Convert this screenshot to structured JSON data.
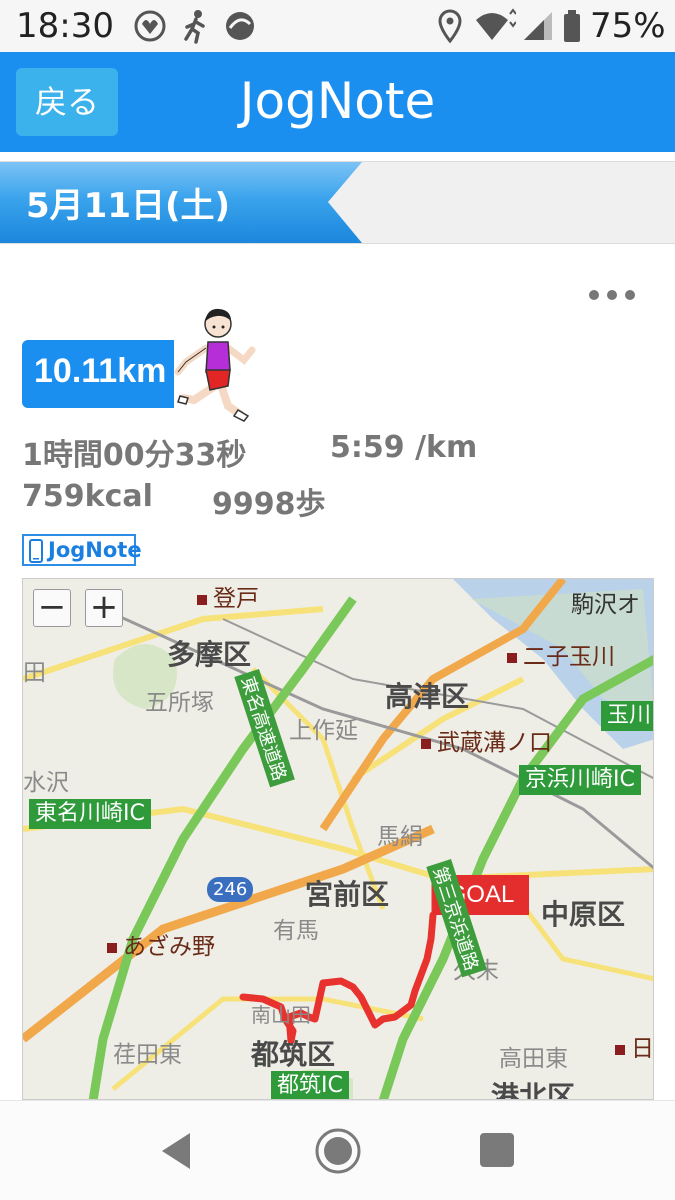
{
  "status_bar": {
    "time": "18:30",
    "battery_percent": "75%",
    "icons": [
      "heart-rate-icon",
      "runner-status-icon",
      "sync-icon",
      "location-icon",
      "wifi-icon",
      "signal-icon",
      "battery-icon"
    ]
  },
  "header": {
    "back_label": "戻る",
    "title": "JogNote"
  },
  "date_strip": {
    "date": "5月11日(土)"
  },
  "record": {
    "distance": "10.11km",
    "duration": "1時間00分33秒",
    "pace": "5:59 /km",
    "calories": "759kcal",
    "steps": "9998歩",
    "logo_text": "JogNote"
  },
  "map": {
    "zoom_out": "−",
    "zoom_in": "+",
    "goal_label": "GOAL",
    "route_color": "#e8322e",
    "labels": {
      "tama": "多摩区",
      "takatsu": "高津区",
      "miyamae": "宮前区",
      "nakahara": "中原区",
      "tsuzuki": "都筑区",
      "kohoku": "港北区",
      "gosho": "五所塚",
      "kamisakunobe": "上作延",
      "mizusawa": "水沢",
      "mabeki": "馬絹",
      "arima": "有馬",
      "kusue": "久末",
      "minamiyamada": "南山田",
      "sanedahigashi": "荏田東",
      "takatahigashi": "高田東",
      "komazawa": "駒沢オ",
      "noborito": "登戸",
      "futakotamagawa": "二子玉川",
      "musashimizonokuchi": "武蔵溝ノ口",
      "azamino": "あざみ野",
      "higashi": "日",
      "ta": "田",
      "tame": "玉川",
      "tomei_kawasaki_ic": "東名川崎IC",
      "keihin_kawasaki_ic": "京浜川崎IC",
      "tsuzuki_ic": "都筑IC",
      "route246": "246",
      "tomei_expressway": "東名高速道路",
      "daisan_keihin": "第三京浜道路"
    }
  },
  "nav_bar": {
    "back": "back-triangle-icon",
    "home": "home-circle-icon",
    "recents": "recents-square-icon"
  }
}
